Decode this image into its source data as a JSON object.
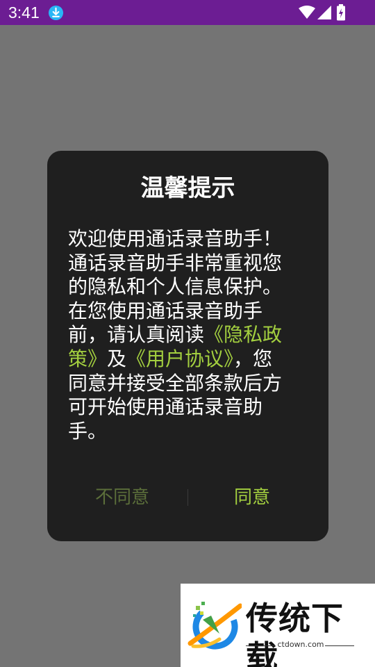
{
  "status_bar": {
    "time": "3:41",
    "icons": [
      "download-icon",
      "wifi-icon",
      "signal-icon",
      "battery-charging-icon"
    ],
    "background_color": "#6c1d93"
  },
  "dialog": {
    "title": "温馨提示",
    "message_parts": [
      "欢迎使用通话录音助手！通话录音助手非常重视您的隐私和个人信息保护。在您使用通话录音助手前，请认真阅读",
      "《隐私政策》",
      "及",
      "《用户协议》",
      "，您同意并接受全部条款后方可开始使用通话录音助手。"
    ],
    "disagree_label": "不同意",
    "agree_label": "同意",
    "link_color": "#a3cf3f"
  },
  "watermark": {
    "name": "传统下载",
    "url": "ctdown.com"
  }
}
